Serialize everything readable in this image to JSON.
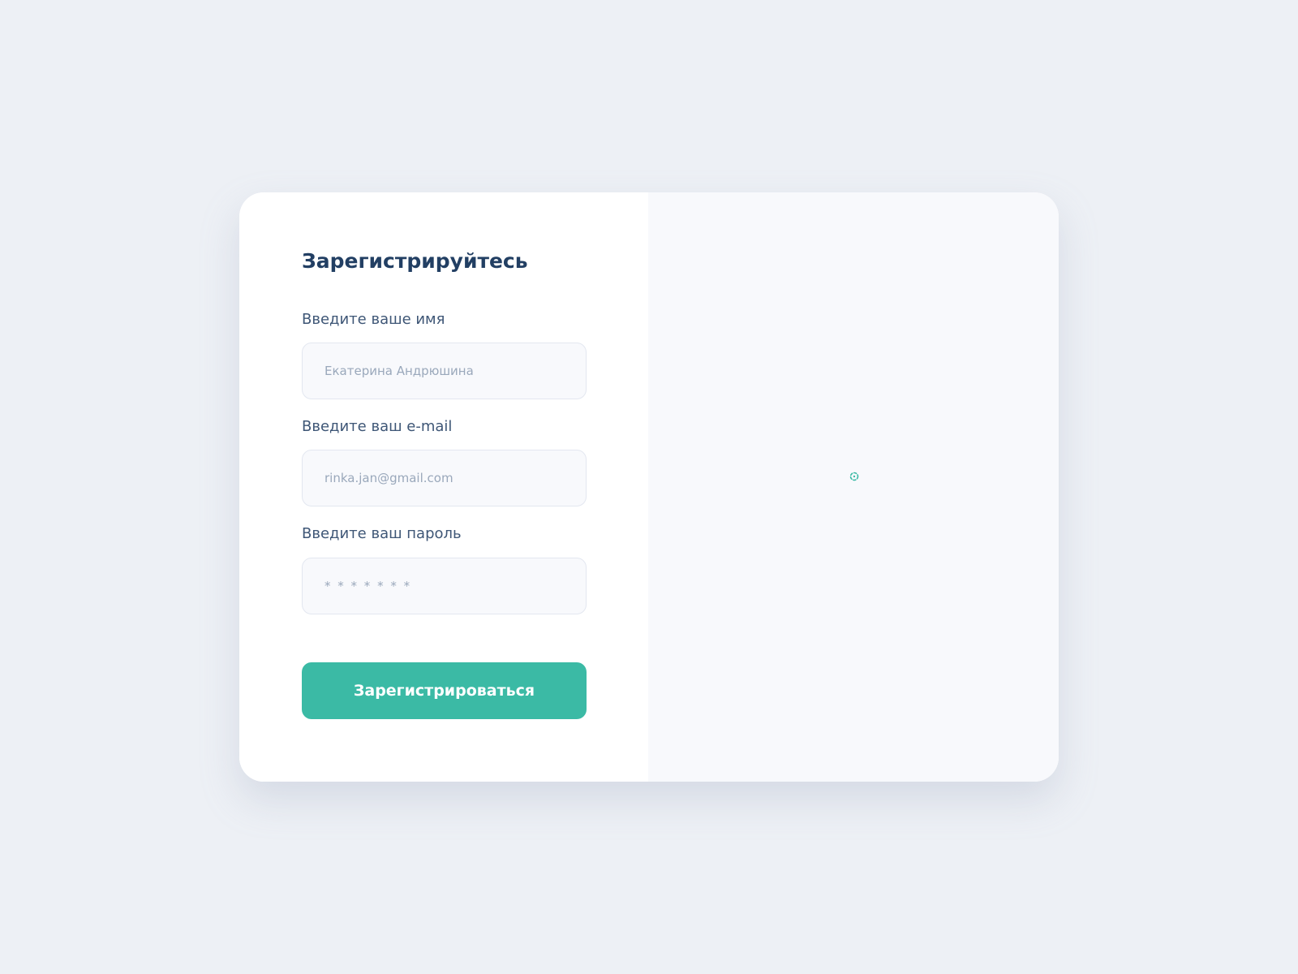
{
  "form": {
    "title": "Зарегистрируйтесь",
    "name_label": "Введите ваше имя",
    "name_placeholder": "Екатерина Андрюшина",
    "email_label": "Введите ваш e-mail",
    "email_placeholder": "rinka.jan@gmail.com",
    "password_label": "Введите ваш пароль",
    "password_placeholder": "* * * * * * *",
    "submit_label": "Зарегистрироваться"
  },
  "side_panel": {
    "loader_icon": "loading-spinner-icon"
  },
  "colors": {
    "accent": "#3bbaa5",
    "title": "#223f63",
    "label": "#3e5676",
    "placeholder": "#9aa8bb",
    "background": "#edf0f5"
  }
}
